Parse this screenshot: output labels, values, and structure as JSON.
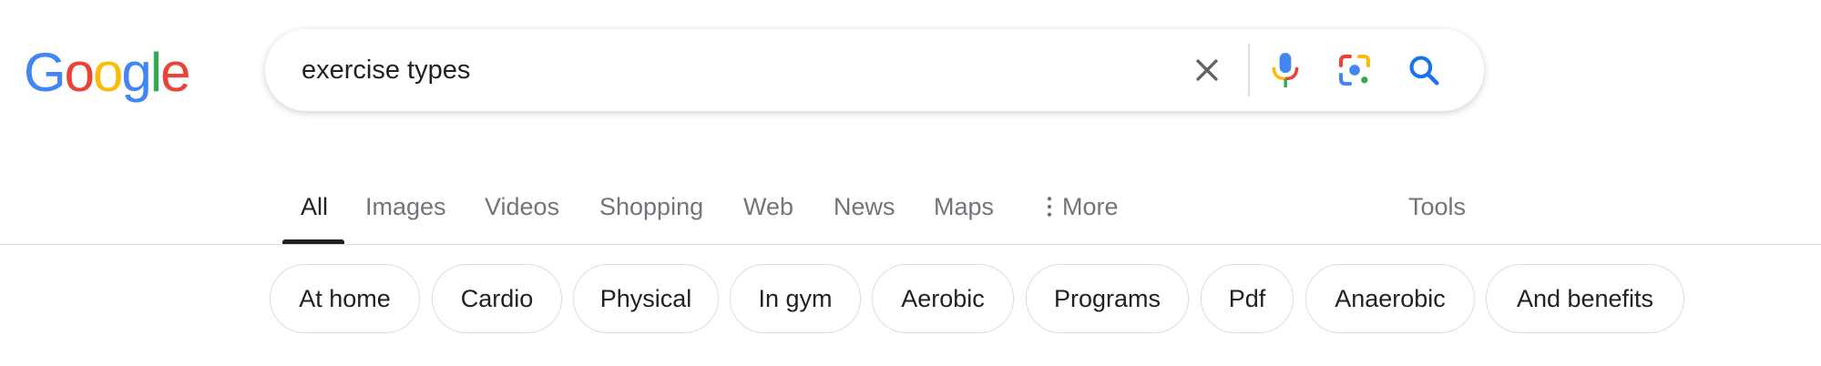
{
  "logo": {
    "letters": [
      {
        "char": "G",
        "color": "#4285F4"
      },
      {
        "char": "o",
        "color": "#EA4335"
      },
      {
        "char": "o",
        "color": "#FBBC05"
      },
      {
        "char": "g",
        "color": "#4285F4"
      },
      {
        "char": "l",
        "color": "#34A853"
      },
      {
        "char": "e",
        "color": "#EA4335"
      }
    ]
  },
  "search": {
    "query": "exercise types",
    "icons": {
      "clear": "close-icon",
      "voice": "microphone-icon",
      "lens": "google-lens-icon",
      "search": "search-icon"
    }
  },
  "tabs": [
    {
      "label": "All",
      "active": true
    },
    {
      "label": "Images"
    },
    {
      "label": "Videos"
    },
    {
      "label": "Shopping"
    },
    {
      "label": "Web"
    },
    {
      "label": "News"
    },
    {
      "label": "Maps"
    },
    {
      "label": "More",
      "icon": "more-vert-icon"
    },
    {
      "label": "Tools"
    }
  ],
  "chips": [
    "At home",
    "Cardio",
    "Physical",
    "In gym",
    "Aerobic",
    "Programs",
    "Pdf",
    "Anaerobic",
    "And benefits"
  ],
  "colors": {
    "blue": "#4285F4",
    "red": "#EA4335",
    "yellow": "#FBBC05",
    "green": "#34A853",
    "search_blue": "#1a73e8"
  }
}
